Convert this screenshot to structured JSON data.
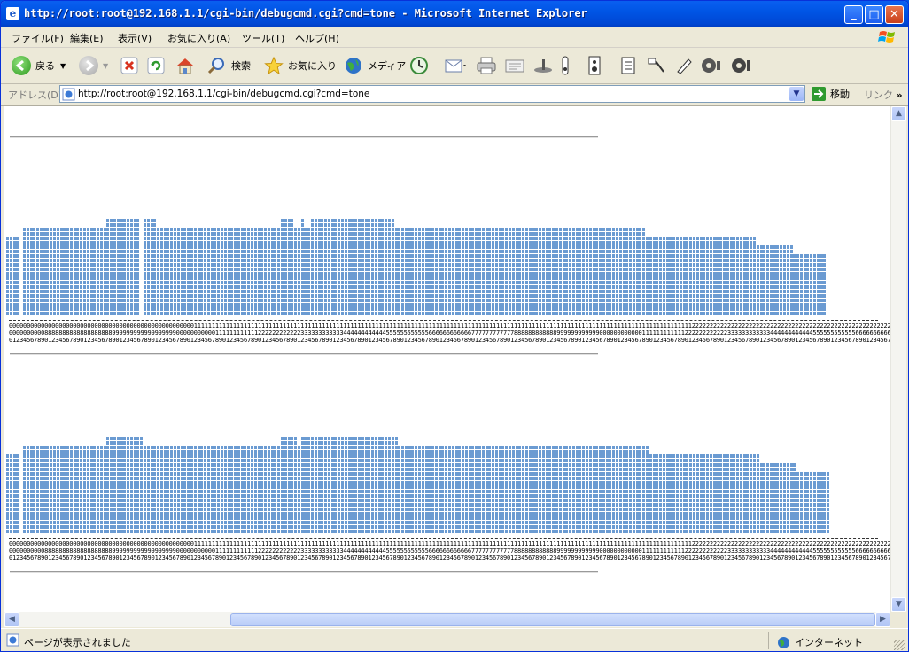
{
  "window": {
    "title": "http://root:root@192.168.1.1/cgi-bin/debugcmd.cgi?cmd=tone - Microsoft Internet Explorer"
  },
  "menu": [
    "ファイル(F)",
    "編集(E)",
    "表示(V)",
    "お気に入り(A)",
    "ツール(T)",
    "ヘルプ(H)"
  ],
  "toolbar": {
    "back_label": "戻る",
    "search_label": "検索",
    "favorites_label": "お気に入り",
    "media_label": "メディア"
  },
  "address": {
    "label": "アドレス(D)",
    "url": "http://root:root@192.168.1.1/cgi-bin/debugcmd.cgi?cmd=tone",
    "go_label": "移動",
    "links_label": "リンク"
  },
  "status": {
    "text": "ページが表示されました",
    "zone": "インターネット"
  },
  "colors": {
    "bar": "#6b9bd2",
    "titlebar": "#0055e5"
  },
  "chart_data": [
    {
      "type": "bar",
      "values": [
        9,
        9,
        9,
        9,
        0,
        10,
        10,
        10,
        10,
        10,
        10,
        10,
        10,
        10,
        10,
        10,
        10,
        10,
        10,
        10,
        10,
        10,
        10,
        10,
        10,
        10,
        10,
        10,
        10,
        10,
        11,
        11,
        11,
        11,
        11,
        11,
        11,
        11,
        11,
        11,
        0,
        11,
        11,
        11,
        11,
        10,
        10,
        10,
        10,
        10,
        10,
        10,
        10,
        10,
        10,
        10,
        10,
        10,
        10,
        10,
        10,
        10,
        10,
        10,
        10,
        10,
        10,
        10,
        10,
        10,
        10,
        10,
        10,
        10,
        10,
        10,
        10,
        10,
        10,
        10,
        10,
        10,
        11,
        11,
        11,
        11,
        10,
        10,
        11,
        10,
        10,
        11,
        11,
        11,
        11,
        11,
        11,
        11,
        11,
        11,
        11,
        11,
        11,
        11,
        11,
        11,
        11,
        11,
        11,
        11,
        11,
        11,
        11,
        11,
        11,
        11,
        10,
        10,
        10,
        10,
        10,
        10,
        10,
        10,
        10,
        10,
        10,
        10,
        10,
        10,
        10,
        10,
        10,
        10,
        10,
        10,
        10,
        10,
        10,
        10,
        10,
        10,
        10,
        10,
        10,
        10,
        10,
        10,
        10,
        10,
        10,
        10,
        10,
        10,
        10,
        10,
        10,
        10,
        10,
        10,
        10,
        10,
        10,
        10,
        10,
        10,
        10,
        10,
        10,
        10,
        10,
        10,
        10,
        10,
        10,
        10,
        10,
        10,
        10,
        10,
        10,
        10,
        10,
        10,
        10,
        10,
        10,
        10,
        10,
        10,
        10,
        9,
        9,
        9,
        9,
        9,
        9,
        9,
        9,
        9,
        9,
        9,
        9,
        9,
        9,
        9,
        9,
        9,
        9,
        9,
        9,
        9,
        9,
        9,
        9,
        9,
        9,
        9,
        9,
        9,
        9,
        9,
        9,
        9,
        8,
        8,
        8,
        8,
        8,
        8,
        8,
        8,
        8,
        8,
        8,
        7,
        7,
        7,
        7,
        7,
        7,
        7,
        7,
        7,
        7
      ],
      "digit_rows": [
        "0000000000000000000000000000000000000000000000000000111111111111111111111111111111111111111111111111111111111111111111111111111111111111111111111111111111111111111111111111111111111111111111112222222222222222222222222222222222222222222222222222222222222222222222222222222222222222N",
        "0000000000888888888888888888899999999999999999900000000000111111111111222222222222333333333333444444444444555555555555666666666666777777777777888888888888999999999999000000000000111111111111222222222222333333333333444444444444555555555555666666666666777777777777888888888888999999995",
        "01234567890123456789012345678901234567890123456789012345678901234567890123456789012345678901234567890123456789012345678901234567890123456789012345678901234567890123456789012345678901234567890123456789012345678901234567890123456789012345678901234567890123456789012345"
      ]
    },
    {
      "type": "bar",
      "values": [
        9,
        9,
        9,
        9,
        0,
        10,
        10,
        10,
        10,
        10,
        10,
        10,
        10,
        10,
        10,
        10,
        10,
        10,
        10,
        10,
        10,
        10,
        10,
        10,
        10,
        10,
        10,
        10,
        10,
        10,
        11,
        11,
        11,
        11,
        11,
        11,
        11,
        11,
        11,
        11,
        11,
        10,
        10,
        10,
        10,
        10,
        10,
        10,
        10,
        10,
        10,
        10,
        10,
        10,
        10,
        10,
        10,
        10,
        10,
        10,
        10,
        10,
        10,
        10,
        10,
        10,
        10,
        10,
        10,
        10,
        10,
        10,
        10,
        10,
        10,
        10,
        10,
        10,
        10,
        10,
        10,
        10,
        11,
        11,
        11,
        11,
        11,
        10,
        11,
        11,
        11,
        11,
        11,
        11,
        11,
        11,
        11,
        11,
        11,
        11,
        11,
        11,
        11,
        11,
        11,
        11,
        11,
        11,
        11,
        11,
        11,
        11,
        11,
        11,
        11,
        11,
        11,
        10,
        10,
        10,
        10,
        10,
        10,
        10,
        10,
        10,
        10,
        10,
        10,
        10,
        10,
        10,
        10,
        10,
        10,
        10,
        10,
        10,
        10,
        10,
        10,
        10,
        10,
        10,
        10,
        10,
        10,
        10,
        10,
        10,
        10,
        10,
        10,
        10,
        10,
        10,
        10,
        10,
        10,
        10,
        10,
        10,
        10,
        10,
        10,
        10,
        10,
        10,
        10,
        10,
        10,
        10,
        10,
        10,
        10,
        10,
        10,
        10,
        10,
        10,
        10,
        10,
        10,
        10,
        10,
        10,
        10,
        10,
        10,
        10,
        10,
        10,
        9,
        9,
        9,
        9,
        9,
        9,
        9,
        9,
        9,
        9,
        9,
        9,
        9,
        9,
        9,
        9,
        9,
        9,
        9,
        9,
        9,
        9,
        9,
        9,
        9,
        9,
        9,
        9,
        9,
        9,
        9,
        9,
        9,
        8,
        8,
        8,
        8,
        8,
        8,
        8,
        8,
        8,
        8,
        8,
        7,
        7,
        7,
        7,
        7,
        7,
        7,
        7,
        7,
        7
      ],
      "digit_rows": [
        "0000000000000000000000000000000000000000000000000000111111111111111111111111111111111111111111111111111111111111111111111111111111111111111111111111111111111111111111111111111111111111111111112222222222222222222222222222222222222222222222222222222222222222222222222222222222222222N",
        "0000000000888888888888888888899999999999999999900000000000111111111111222222222222333333333333444444444444555555555555666666666666777777777777888888888888999999999999000000000000111111111111222222222222333333333333444444444444555555555555666666666666777777777777888888888888999999995",
        "01234567890123456789012345678901234567890123456789012345678901234567890123456789012345678901234567890123456789012345678901234567890123456789012345678901234567890123456789012345678901234567890123456789012345678901234567890123456789012345678901234567890123456789012345"
      ]
    }
  ]
}
